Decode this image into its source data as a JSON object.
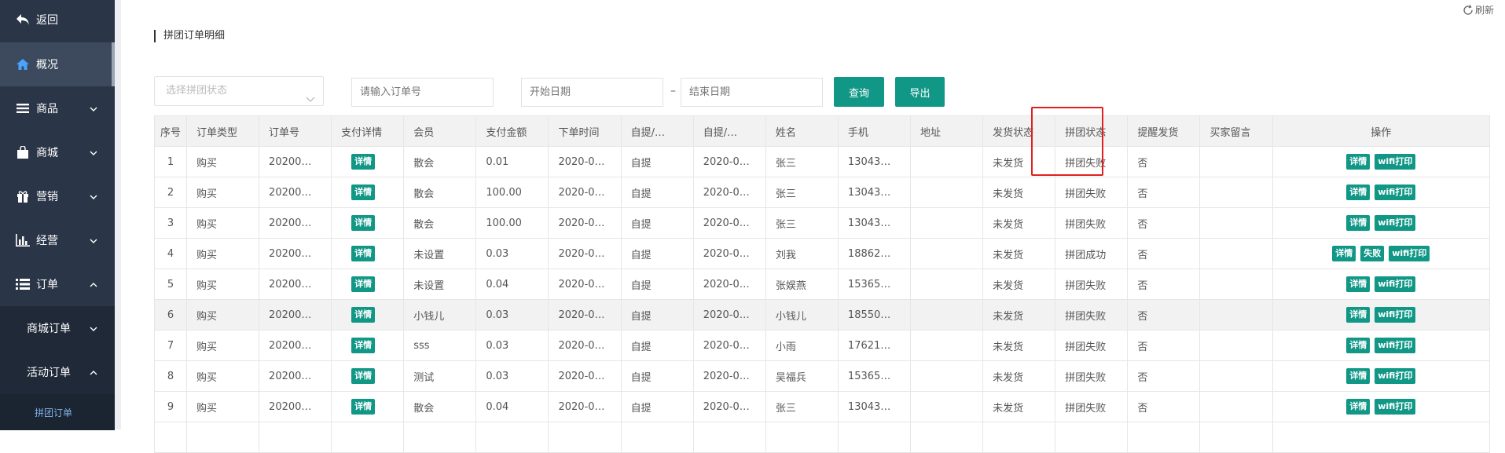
{
  "sidebar": {
    "back": "返回",
    "overview": "概况",
    "goods": "商品",
    "mall": "商城",
    "marketing": "营销",
    "business": "经营",
    "orders": "订单",
    "mall_orders": "商城订单",
    "activity_orders": "活动订单",
    "group_orders": "拼团订单"
  },
  "header": {
    "title": "拼团订单明细",
    "refresh": "刷新"
  },
  "filters": {
    "status_placeholder": "选择拼团状态",
    "order_no_placeholder": "请输入订单号",
    "start_date_placeholder": "开始日期",
    "end_date_placeholder": "结束日期",
    "dash": "–",
    "query": "查询",
    "export": "导出"
  },
  "table": {
    "headers": [
      "序号",
      "订单类型",
      "订单号",
      "支付详情",
      "会员",
      "支付金额",
      "下单时间",
      "自提/…",
      "自提/…",
      "姓名",
      "手机",
      "地址",
      "发货状态",
      "拼团状态",
      "提醒发货",
      "买家留言",
      "操作"
    ],
    "detail_tag": "详情",
    "action_labels": {
      "detail": "详情",
      "fail": "失败",
      "print": "wifi打印"
    },
    "rows": [
      {
        "no": "1",
        "type": "购买",
        "order": "20200…",
        "member": "散会",
        "amount": "0.01",
        "time": "2020-0…",
        "pick": "自提",
        "pick2": "2020-0…",
        "name": "张三",
        "phone": "13043…",
        "addr": "",
        "ship": "未发货",
        "group": "拼团失败",
        "remind": "否",
        "msg": "",
        "actions": [
          "detail",
          "print"
        ]
      },
      {
        "no": "2",
        "type": "购买",
        "order": "20200…",
        "member": "散会",
        "amount": "100.00",
        "time": "2020-0…",
        "pick": "自提",
        "pick2": "2020-0…",
        "name": "张三",
        "phone": "13043…",
        "addr": "",
        "ship": "未发货",
        "group": "拼团失败",
        "remind": "否",
        "msg": "",
        "actions": [
          "detail",
          "print"
        ]
      },
      {
        "no": "3",
        "type": "购买",
        "order": "20200…",
        "member": "散会",
        "amount": "100.00",
        "time": "2020-0…",
        "pick": "自提",
        "pick2": "2020-0…",
        "name": "张三",
        "phone": "13043…",
        "addr": "",
        "ship": "未发货",
        "group": "拼团失败",
        "remind": "否",
        "msg": "",
        "actions": [
          "detail",
          "print"
        ]
      },
      {
        "no": "4",
        "type": "购买",
        "order": "20200…",
        "member": "未设置",
        "amount": "0.03",
        "time": "2020-0…",
        "pick": "自提",
        "pick2": "2020-0…",
        "name": "刘我",
        "phone": "18862…",
        "addr": "",
        "ship": "未发货",
        "group": "拼团成功",
        "remind": "否",
        "msg": "",
        "actions": [
          "detail",
          "fail",
          "print"
        ]
      },
      {
        "no": "5",
        "type": "购买",
        "order": "20200…",
        "member": "未设置",
        "amount": "0.04",
        "time": "2020-0…",
        "pick": "自提",
        "pick2": "2020-0…",
        "name": "张娱燕",
        "phone": "15365…",
        "addr": "",
        "ship": "未发货",
        "group": "拼团失败",
        "remind": "否",
        "msg": "",
        "actions": [
          "detail",
          "print"
        ]
      },
      {
        "no": "6",
        "type": "购买",
        "order": "20200…",
        "member": "小钱儿",
        "amount": "0.03",
        "time": "2020-0…",
        "pick": "自提",
        "pick2": "2020-0…",
        "name": "小钱儿",
        "phone": "18550…",
        "addr": "",
        "ship": "未发货",
        "group": "拼团失败",
        "remind": "否",
        "msg": "",
        "actions": [
          "detail",
          "print"
        ],
        "highlight": true
      },
      {
        "no": "7",
        "type": "购买",
        "order": "20200…",
        "member": "sss",
        "amount": "0.03",
        "time": "2020-0…",
        "pick": "自提",
        "pick2": "2020-0…",
        "name": "小雨",
        "phone": "17621…",
        "addr": "",
        "ship": "未发货",
        "group": "拼团失败",
        "remind": "否",
        "msg": "",
        "actions": [
          "detail",
          "print"
        ]
      },
      {
        "no": "8",
        "type": "购买",
        "order": "20200…",
        "member": "测试",
        "amount": "0.03",
        "time": "2020-0…",
        "pick": "自提",
        "pick2": "2020-0…",
        "name": "吴福兵",
        "phone": "15365…",
        "addr": "",
        "ship": "未发货",
        "group": "拼团失败",
        "remind": "否",
        "msg": "",
        "actions": [
          "detail",
          "print"
        ]
      },
      {
        "no": "9",
        "type": "购买",
        "order": "20200…",
        "member": "散会",
        "amount": "0.04",
        "time": "2020-0…",
        "pick": "自提",
        "pick2": "2020-0…",
        "name": "张三",
        "phone": "13043…",
        "addr": "",
        "ship": "未发货",
        "group": "拼团失败",
        "remind": "否",
        "msg": "",
        "actions": [
          "detail",
          "print"
        ]
      },
      {
        "no": "",
        "type": "",
        "order": "",
        "member": "",
        "amount": "",
        "time": "",
        "pick": "",
        "pick2": "",
        "name": "",
        "phone": "",
        "addr": "",
        "ship": "",
        "group": "",
        "remind": "",
        "msg": "",
        "actions": [],
        "partial": true
      }
    ]
  },
  "colors": {
    "sidebar": "#2a3547",
    "accent": "#119786",
    "highlight_box": "#e02020"
  }
}
